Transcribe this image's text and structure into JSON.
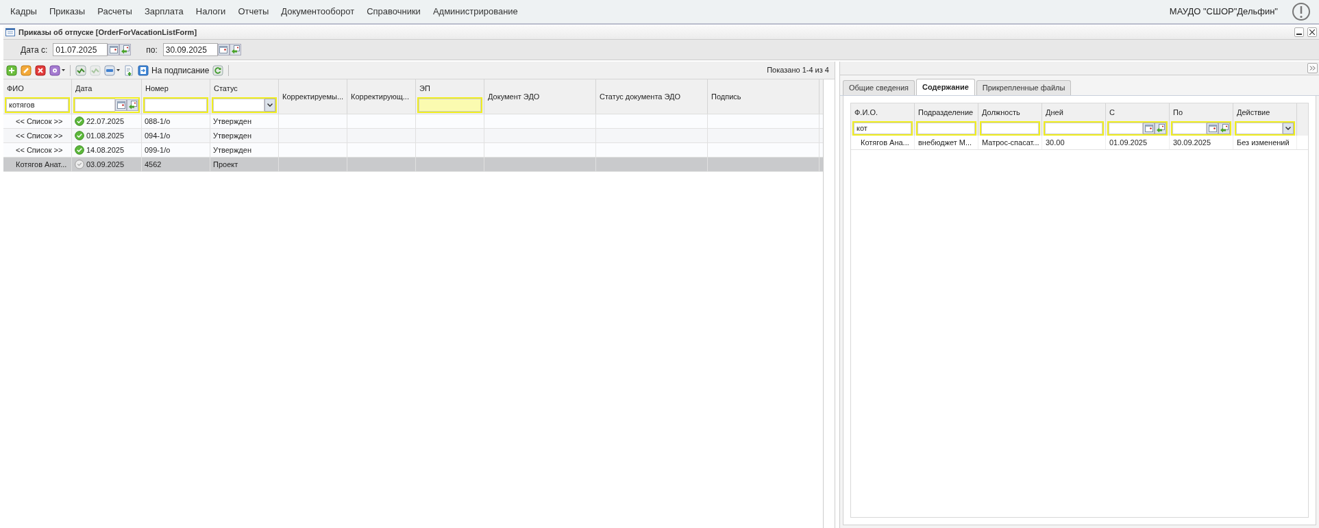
{
  "menu": {
    "items": [
      "Кадры",
      "Приказы",
      "Расчеты",
      "Зарплата",
      "Налоги",
      "Отчеты",
      "Документооборот",
      "Справочники",
      "Администрирование"
    ],
    "organization": "МАУДО \"СШОР\"Дельфин\""
  },
  "window": {
    "title": "Приказы об отпуске [OrderForVacationListForm]"
  },
  "date_filter": {
    "from_label": "Дата с:",
    "from_value": "01.07.2025",
    "to_label": "по:",
    "to_value": "30.09.2025"
  },
  "toolbar": {
    "items": [
      {
        "kind": "add",
        "disabled": false,
        "dropdown": false
      },
      {
        "kind": "edit",
        "disabled": false,
        "dropdown": false
      },
      {
        "kind": "delete",
        "disabled": false,
        "dropdown": false
      },
      {
        "kind": "gear",
        "disabled": false,
        "dropdown": true
      },
      {
        "kind": "separator"
      },
      {
        "kind": "approve",
        "disabled": false,
        "dropdown": false
      },
      {
        "kind": "approve",
        "disabled": true,
        "dropdown": false
      },
      {
        "kind": "print",
        "disabled": false,
        "dropdown": true
      },
      {
        "kind": "export",
        "disabled": false,
        "dropdown": false
      },
      {
        "kind": "sign",
        "disabled": false,
        "dropdown": false,
        "label": "На подписание"
      },
      {
        "kind": "refresh",
        "disabled": false,
        "dropdown": false
      },
      {
        "kind": "separator"
      }
    ],
    "paging": "Показано 1-4 из 4"
  },
  "table": {
    "columns": [
      {
        "label": "ФИО",
        "filter": {
          "kind": "text",
          "value": "котягов",
          "focused": false
        }
      },
      {
        "label": "Дата",
        "filter": {
          "kind": "date",
          "focused": false
        }
      },
      {
        "label": "Номер",
        "filter": {
          "kind": "text",
          "focused": false
        }
      },
      {
        "label": "Статус",
        "filter": {
          "kind": "select",
          "focused": false
        }
      },
      {
        "label": "Корректируемы...",
        "filter": {
          "kind": "none"
        }
      },
      {
        "label": "Корректирующ...",
        "filter": {
          "kind": "none"
        }
      },
      {
        "label": "ЭП",
        "filter": {
          "kind": "text",
          "focused": true
        }
      },
      {
        "label": "Документ ЭДО",
        "filter": {
          "kind": "none"
        }
      },
      {
        "label": "Статус документа ЭДО",
        "filter": {
          "kind": "none"
        }
      },
      {
        "label": "Подпись",
        "filter": {
          "kind": "none"
        }
      }
    ],
    "rows": [
      {
        "selected": false,
        "approved": true,
        "cells": [
          "<< Список >>",
          "22.07.2025",
          "088-1/о",
          "Утвержден"
        ]
      },
      {
        "selected": false,
        "approved": true,
        "cells": [
          "<< Список >>",
          "01.08.2025",
          "094-1/о",
          "Утвержден"
        ]
      },
      {
        "selected": false,
        "approved": true,
        "cells": [
          "<< Список >>",
          "14.08.2025",
          "099-1/о",
          "Утвержден"
        ]
      },
      {
        "selected": true,
        "approved": false,
        "cells": [
          "Котягов Анат...",
          "03.09.2025",
          "4562",
          "Проект"
        ]
      }
    ]
  },
  "detail": {
    "tabs": [
      {
        "label": "Общие сведения",
        "selected": false
      },
      {
        "label": "Содержание",
        "selected": true
      },
      {
        "label": "Прикрепленные файлы",
        "selected": false
      }
    ],
    "table": {
      "columns": [
        {
          "label": "Ф.И.О.",
          "filter": {
            "kind": "text",
            "value": "кот",
            "focused": false
          }
        },
        {
          "label": "Подразделение",
          "filter": {
            "kind": "text",
            "focused": false
          }
        },
        {
          "label": "Должность",
          "filter": {
            "kind": "text",
            "focused": false
          }
        },
        {
          "label": "Дней",
          "filter": {
            "kind": "text",
            "focused": false
          }
        },
        {
          "label": "С",
          "filter": {
            "kind": "date",
            "focused": false
          }
        },
        {
          "label": "По",
          "filter": {
            "kind": "date",
            "focused": false
          }
        },
        {
          "label": "Действие",
          "filter": {
            "kind": "select",
            "focused": false
          }
        }
      ],
      "rows": [
        {
          "selected": false,
          "cells": [
            "Котягов Ана...",
            "внебюджет М...",
            "Матрос-спасат...",
            "30.00",
            "01.09.2025",
            "30.09.2025",
            "Без изменений"
          ]
        }
      ]
    }
  }
}
